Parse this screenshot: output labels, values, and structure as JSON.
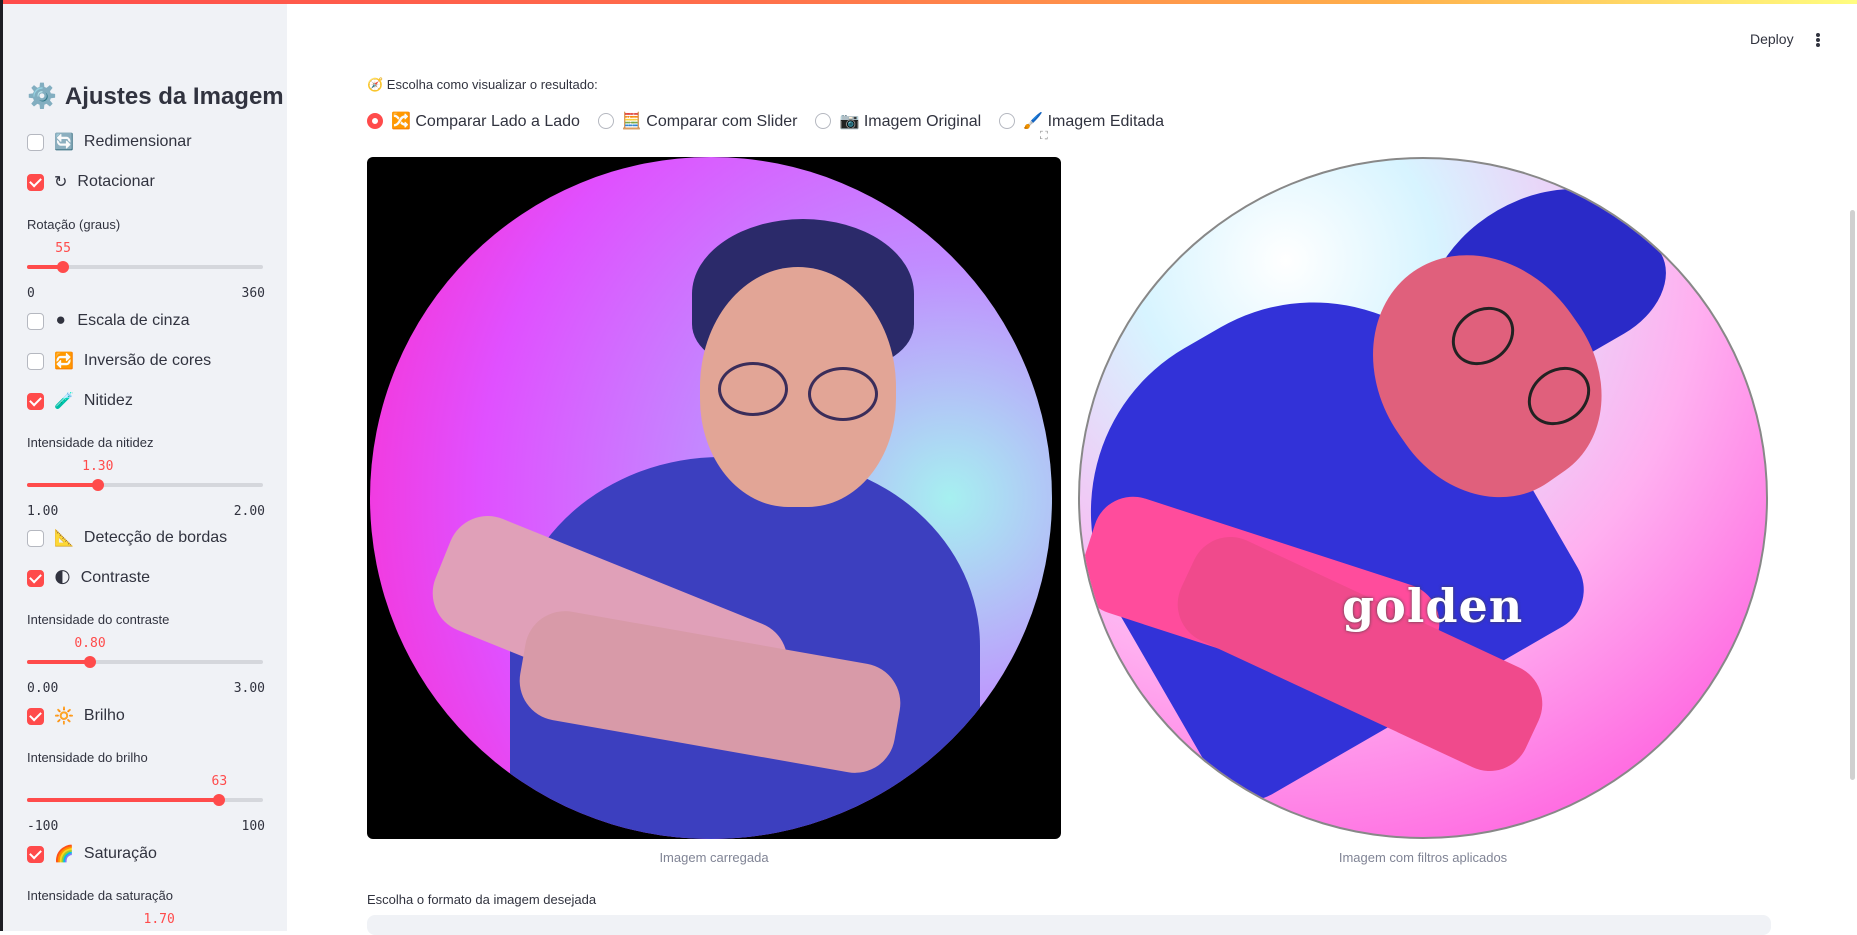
{
  "sidebar": {
    "title": "Ajustes da Imagem",
    "title_icon": "⚙️",
    "controls": [
      {
        "type": "checkbox",
        "label": "Redimensionar",
        "emoji": "🔄",
        "checked": false
      },
      {
        "type": "checkbox",
        "label": "Rotacionar",
        "emoji": "↻",
        "checked": true
      },
      {
        "type": "slider",
        "label": "Rotação (graus)",
        "value": "55",
        "min": "0",
        "max": "360",
        "fraction": 0.153
      },
      {
        "type": "checkbox",
        "label": "Escala de cinza",
        "emoji": "⚫",
        "checked": false
      },
      {
        "type": "checkbox",
        "label": "Inversão de cores",
        "emoji": "🔁",
        "checked": false
      },
      {
        "type": "checkbox",
        "label": "Nitidez",
        "emoji": "🧪",
        "checked": true
      },
      {
        "type": "slider",
        "label": "Intensidade da nitidez",
        "value": "1.30",
        "min": "1.00",
        "max": "2.00",
        "fraction": 0.3
      },
      {
        "type": "checkbox",
        "label": "Detecção de bordas",
        "emoji": "📐",
        "checked": false
      },
      {
        "type": "checkbox",
        "label": "Contraste",
        "emoji": "🌓",
        "checked": true
      },
      {
        "type": "slider",
        "label": "Intensidade do contraste",
        "value": "0.80",
        "min": "0.00",
        "max": "3.00",
        "fraction": 0.267
      },
      {
        "type": "checkbox",
        "label": "Brilho",
        "emoji": "🔆",
        "checked": true
      },
      {
        "type": "slider",
        "label": "Intensidade do brilho",
        "value": "63",
        "min": "-100",
        "max": "100",
        "fraction": 0.815
      },
      {
        "type": "checkbox",
        "label": "Saturação",
        "emoji": "🌈",
        "checked": true
      },
      {
        "type": "slider",
        "label": "Intensidade da saturação",
        "value": "1.70",
        "min": "",
        "max": "",
        "fraction": 0.56
      }
    ]
  },
  "header": {
    "deploy_label": "Deploy"
  },
  "main": {
    "view_label": "🧭 Escolha como visualizar o resultado:",
    "view_options": [
      {
        "label": "🔀 Comparar Lado a Lado",
        "selected": true
      },
      {
        "label": "🧮 Comparar com Slider",
        "selected": false
      },
      {
        "label": "📷 Imagem Original",
        "selected": false
      },
      {
        "label": "🖌️ Imagem Editada",
        "selected": false
      }
    ],
    "caption_original": "Imagem carregada",
    "caption_edited": "Imagem com filtros aplicados",
    "watermark_text": "golden",
    "format_label": "Escolha o formato da imagem desejada"
  },
  "colors": {
    "accent": "#ff4b4b",
    "sidebar_bg": "#f0f2f6",
    "text": "#31333f"
  }
}
